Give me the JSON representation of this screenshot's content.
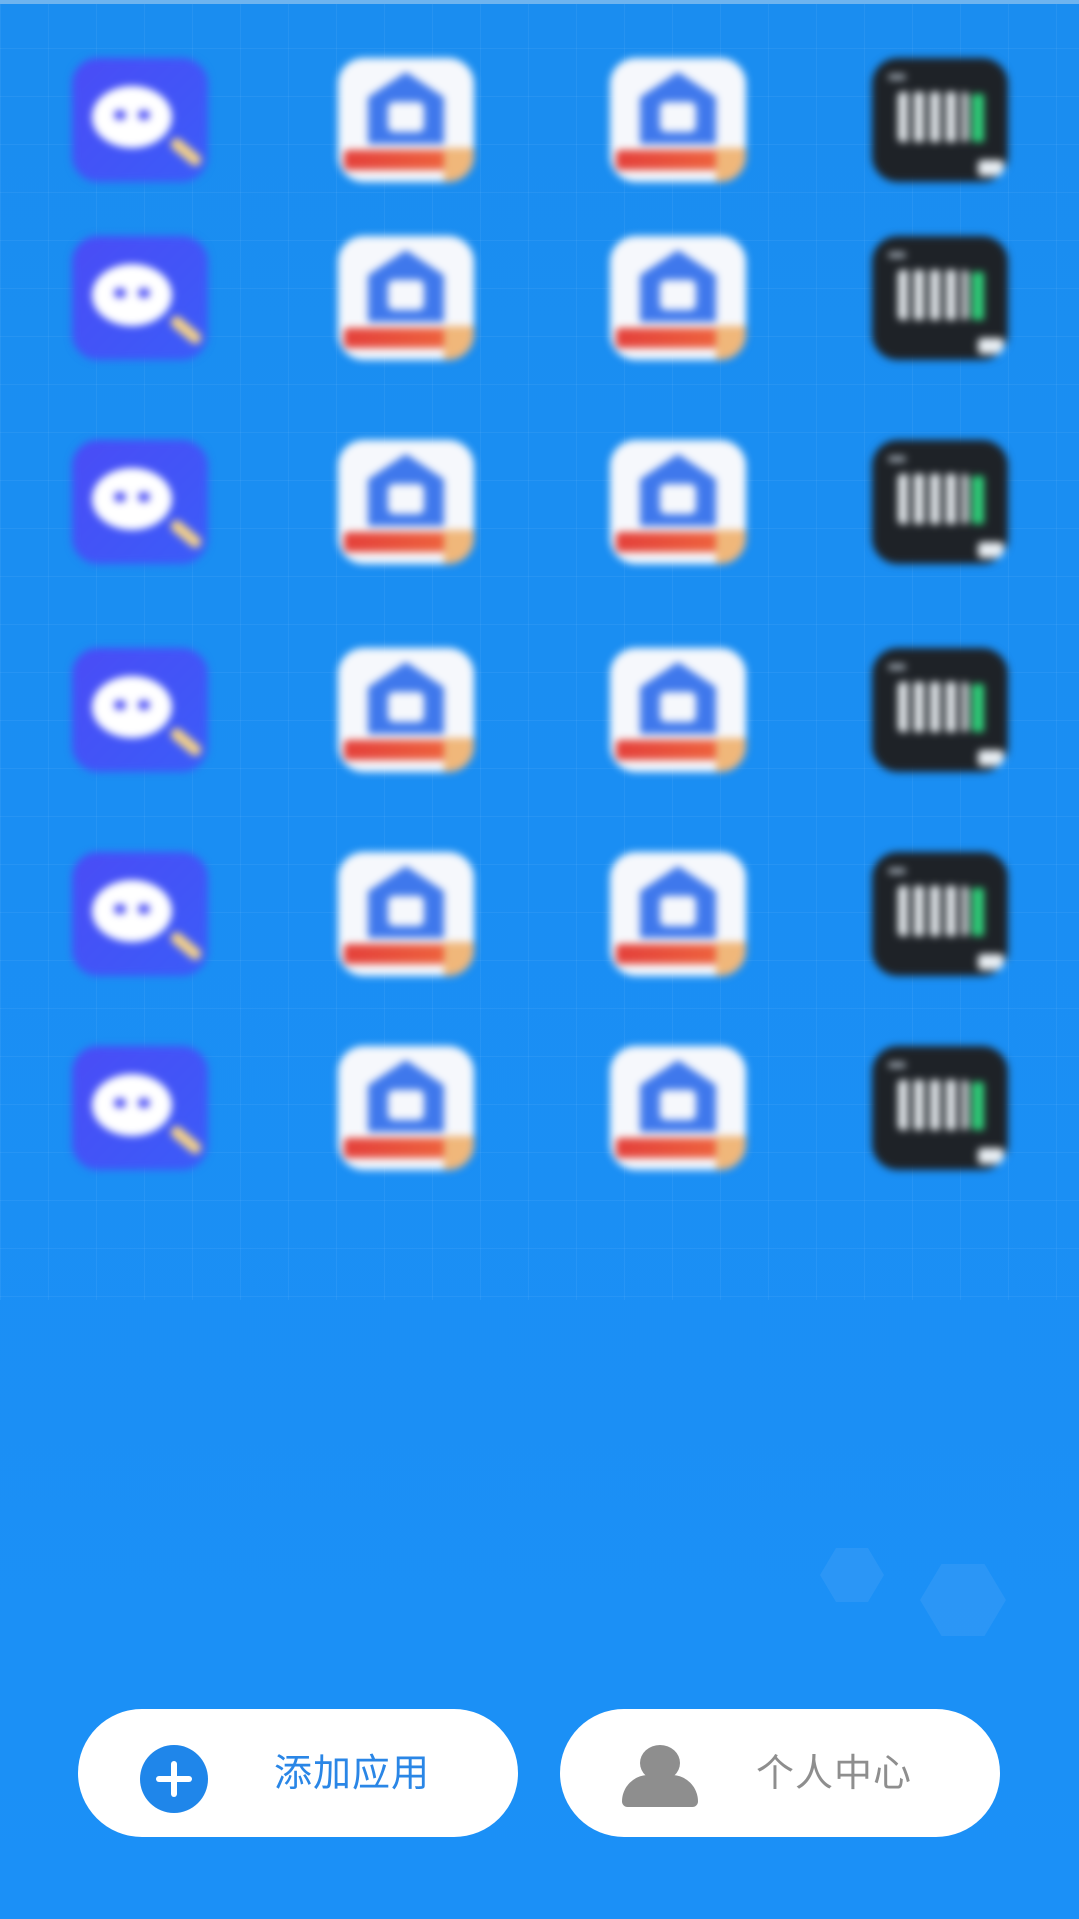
{
  "theme": {
    "background": "#1a8df2",
    "accent": "#2a86e6",
    "muted_text": "#8e8e8e"
  },
  "apps": [
    {
      "icon": "chat-search-app-icon",
      "label": ""
    },
    {
      "icon": "house-app-icon",
      "label": ""
    },
    {
      "icon": "house-app-icon",
      "label": ""
    },
    {
      "icon": "terminal-app-icon",
      "label": ""
    },
    {
      "icon": "chat-search-app-icon",
      "label": ""
    },
    {
      "icon": "house-app-icon",
      "label": ""
    },
    {
      "icon": "house-app-icon",
      "label": ""
    },
    {
      "icon": "terminal-app-icon",
      "label": ""
    },
    {
      "icon": "chat-search-app-icon",
      "label": ""
    },
    {
      "icon": "house-app-icon",
      "label": ""
    },
    {
      "icon": "house-app-icon",
      "label": ""
    },
    {
      "icon": "terminal-app-icon",
      "label": ""
    },
    {
      "icon": "chat-search-app-icon",
      "label": ""
    },
    {
      "icon": "house-app-icon",
      "label": ""
    },
    {
      "icon": "house-app-icon",
      "label": ""
    },
    {
      "icon": "terminal-app-icon",
      "label": ""
    },
    {
      "icon": "chat-search-app-icon",
      "label": ""
    },
    {
      "icon": "house-app-icon",
      "label": ""
    },
    {
      "icon": "house-app-icon",
      "label": ""
    },
    {
      "icon": "terminal-app-icon",
      "label": ""
    },
    {
      "icon": "chat-search-app-icon",
      "label": ""
    },
    {
      "icon": "house-app-icon",
      "label": ""
    },
    {
      "icon": "house-app-icon",
      "label": ""
    },
    {
      "icon": "terminal-app-icon",
      "label": ""
    }
  ],
  "bottom_bar": {
    "add_app": {
      "icon": "plus-circle-icon",
      "label": "添加应用"
    },
    "profile": {
      "icon": "person-icon",
      "label": "个人中心"
    }
  }
}
